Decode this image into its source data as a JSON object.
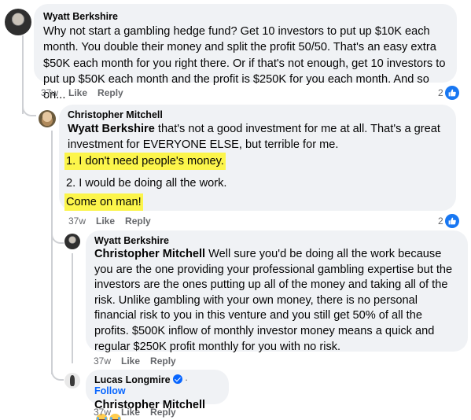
{
  "comments": [
    {
      "author": "Wyatt Berkshire",
      "text": "Why not start a gambling hedge fund? Get 10 investors to put up $10K each month. You double their money and split the profit 50/50. That's an easy extra $50K each month for you right there. Or if that's not enough, get 10 investors to put up $50K each month and the profit is $250K for you each month. And so on...",
      "time": "37w",
      "like_label": "Like",
      "reply_label": "Reply",
      "reaction_count": "2"
    },
    {
      "author": "Christopher Mitchell",
      "mention": "Wyatt Berkshire",
      "text": " that's not a good investment for me at all. That's a great investment for EVERYONE ELSE, but terrible for me.",
      "point1": "1. I don't need people's money.",
      "point2": "2. I would be doing all the work.",
      "closing": "Come on man!",
      "time": "37w",
      "like_label": "Like",
      "reply_label": "Reply",
      "reaction_count": "2"
    },
    {
      "author": "Wyatt Berkshire",
      "mention": "Christopher Mitchell",
      "text": " Well sure you'd be doing all the work because you are the one providing your professional gambling expertise but the investors are the ones putting up all of the money and taking all of the risk. Unlike gambling with your own money, there is no personal financial risk to you in this venture and you still get 50% of all the profits. $500K inflow of monthly investor money means a quick and regular $250K profit monthly for you with no risk.",
      "time": "37w",
      "like_label": "Like",
      "reply_label": "Reply"
    },
    {
      "author": "Lucas Longmire",
      "follow_label": "Follow",
      "separator": " · ",
      "mention": "Christopher Mitchell",
      "time": "37w",
      "like_label": "Like",
      "reply_label": "Reply"
    }
  ],
  "icons": {
    "like_badge": "thumbs-up-icon",
    "verified": "verified-badge-icon",
    "emoji": "laughing-tears-emoji-icon"
  },
  "colors": {
    "bubble": "#f0f2f5",
    "highlight": "#fcf54b",
    "like_blue": "#1877f2",
    "follow_blue": "#0866ff",
    "meta_gray": "#65676b"
  }
}
